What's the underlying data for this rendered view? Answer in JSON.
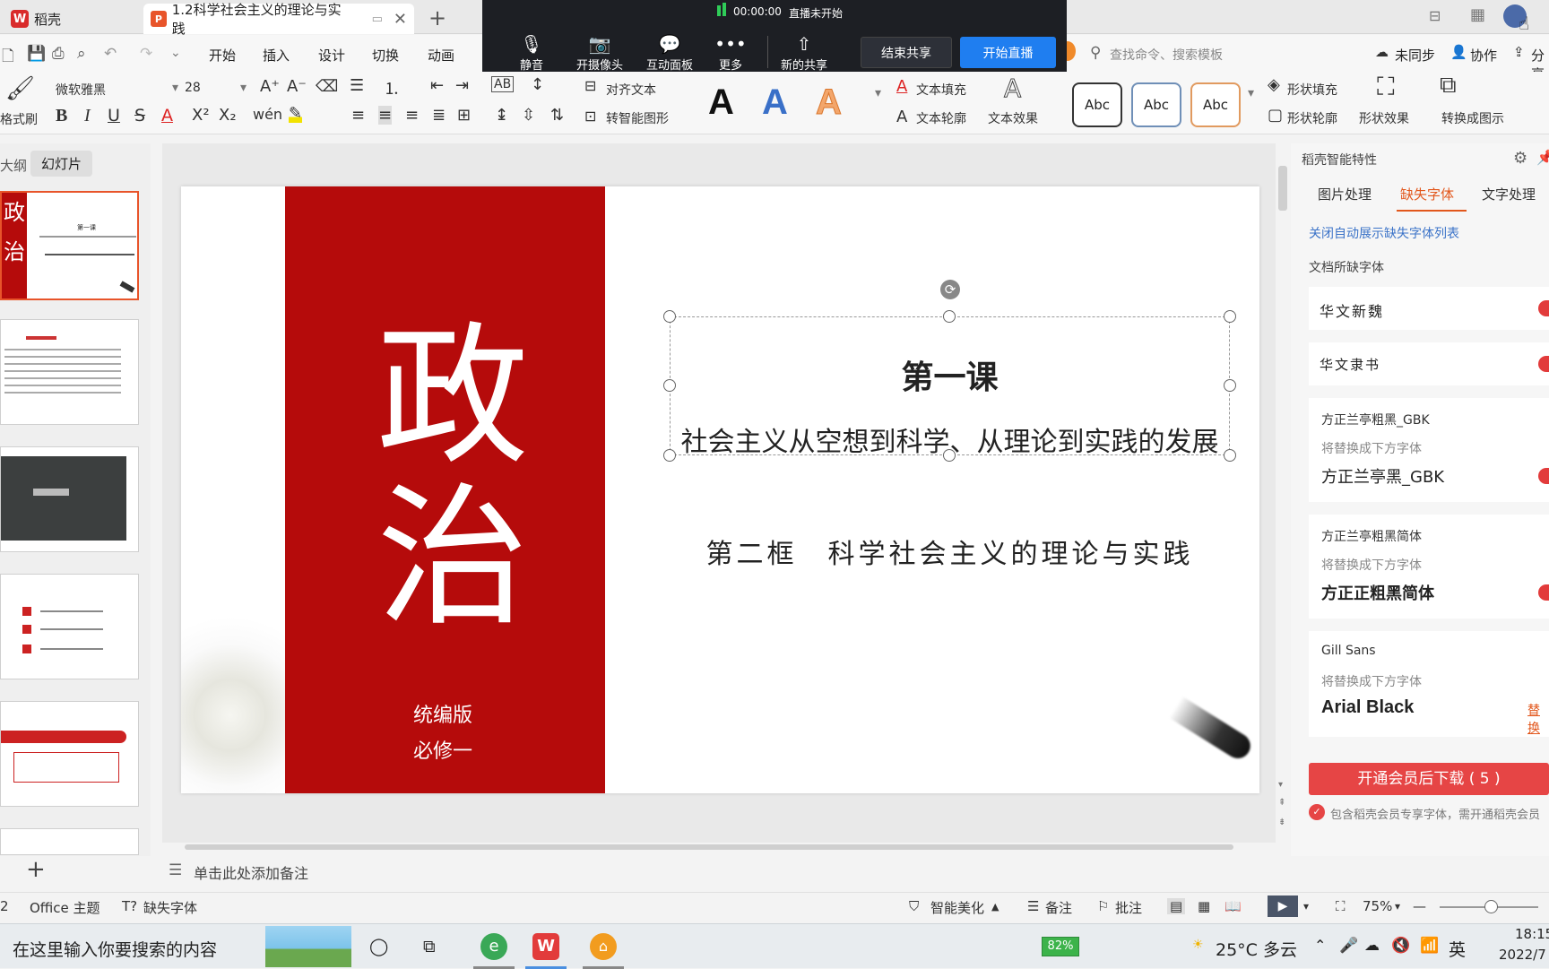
{
  "titlebar": {
    "app_label": "稻壳",
    "doc_tab": "1.2科学社会主义的理论与实践"
  },
  "meeting": {
    "timer": "00:00:00",
    "status": "直播未开始",
    "tools": [
      "静音",
      "开摄像头",
      "互动面板",
      "更多",
      "新的共享"
    ],
    "end_share": "结束共享",
    "start_live": "开始直播"
  },
  "menu": {
    "items": [
      "开始",
      "插入",
      "设计",
      "切换",
      "动画"
    ],
    "search_placeholder": "查找命令、搜索模板",
    "unsynced": "未同步",
    "collab": "协作",
    "share": "分享"
  },
  "ribbon": {
    "format_painter": "格式刷",
    "font_name": "微软雅黑",
    "font_size": "28",
    "align_text": "对齐文本",
    "smart_shape": "转智能图形",
    "text_fill": "文本填充",
    "text_outline": "文本轮廓",
    "text_effect": "文本效果",
    "style_sample": "Abc",
    "shape_fill": "形状填充",
    "shape_outline": "形状轮廓",
    "shape_effect": "形状效果",
    "convert_diagram": "转换成图示"
  },
  "leftpane": {
    "tab_outline": "大纲",
    "tab_slides": "幻灯片"
  },
  "slide": {
    "big_char_1": "政",
    "big_char_2": "治",
    "edition": "统编版",
    "book": "必修一",
    "lesson": "第一课",
    "lesson_title": "社会主义从空想到科学、从理论到实践的发展",
    "frame": "第二框　科学社会主义的理论与实践",
    "brand_color": "#b50b0b"
  },
  "notes_placeholder": "单击此处添加备注",
  "rightpane": {
    "title": "稻壳智能特性",
    "tabs": [
      "图片处理",
      "缺失字体",
      "文字处理"
    ],
    "close_link": "关闭自动展示缺失字体列表",
    "section": "文档所缺字体",
    "fonts": [
      {
        "name": "华文新魏"
      },
      {
        "name": "华文隶书"
      },
      {
        "name": "方正兰亭粗黑_GBK",
        "hint": "将替换成下方字体",
        "replacement": "方正兰亭黑_GBK"
      },
      {
        "name": "方正兰亭粗黑简体",
        "hint": "将替换成下方字体",
        "replacement": "方正正粗黑简体"
      },
      {
        "name": "Gill Sans",
        "hint": "将替换成下方字体",
        "replacement": "Arial Black",
        "action": "替换"
      }
    ],
    "download_button": "开通会员后下载 ( 5 )",
    "footer_note": "包含稻壳会员专享字体，需开通稻壳会员"
  },
  "statusbar": {
    "slide_count": "2",
    "theme": "Office 主题",
    "missing_font": "缺失字体",
    "beautify": "智能美化",
    "notes": "备注",
    "comments": "批注",
    "zoom": "75%"
  },
  "taskbar": {
    "search_placeholder": "在这里输入你要搜索的内容",
    "battery": "82%",
    "weather": "25°C 多云",
    "ime": "英",
    "time": "18:15",
    "date": "2022/7"
  }
}
